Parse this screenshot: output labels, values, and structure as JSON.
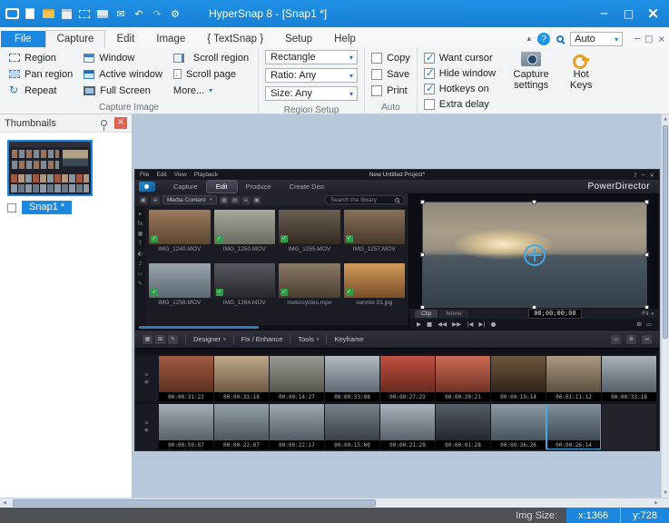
{
  "icons": {
    "minimize": "─",
    "maximize": "□",
    "close": "×",
    "chevron_down": "▾",
    "chevron_up": "▴",
    "help": "?",
    "undo": "↶",
    "redo": "↷",
    "gear": "⚙",
    "email": "✉",
    "repeat": "↻",
    "check": "✓",
    "left": "◀",
    "right": "▶",
    "up": "▲",
    "down": "▼"
  },
  "titlebar": {
    "title": "HyperSnap 8 - [Snap1 *]"
  },
  "tab_row": {
    "tabs": [
      {
        "label": "File",
        "is_file": true
      },
      {
        "label": "Capture",
        "is_active": true
      },
      {
        "label": "Edit"
      },
      {
        "label": "Image"
      },
      {
        "label": "{ TextSnap }"
      },
      {
        "label": "Setup"
      },
      {
        "label": "Help"
      }
    ],
    "zoom_value": "Auto"
  },
  "ribbon": {
    "capture_group": {
      "label": "Capture Image",
      "buttons": [
        {
          "label": "Region"
        },
        {
          "label": "Pan region"
        },
        {
          "label": "Repeat"
        },
        {
          "label": "Window"
        },
        {
          "label": "Active window"
        },
        {
          "label": "Full Screen"
        },
        {
          "label": "Scroll region"
        },
        {
          "label": "Scroll page"
        },
        {
          "label": "More..."
        }
      ]
    },
    "region_setup_group": {
      "label": "Region Setup",
      "dropdowns": [
        {
          "value": "Rectangle"
        },
        {
          "value": "Ratio: Any"
        },
        {
          "value": "Size: Any"
        }
      ]
    },
    "auto_group": {
      "label": "Auto",
      "checkboxes": [
        {
          "label": "Copy",
          "checked": false
        },
        {
          "label": "Save",
          "checked": false
        },
        {
          "label": "Print",
          "checked": false
        }
      ]
    },
    "options_group": {
      "label": "",
      "checkboxes": [
        {
          "label": "Want cursor",
          "checked": true
        },
        {
          "label": "Hide window",
          "checked": true
        },
        {
          "label": "Hotkeys on",
          "checked": true
        },
        {
          "label": "Extra delay",
          "checked": false
        }
      ],
      "buttons": [
        {
          "label": "Capture settings"
        },
        {
          "label": "Hot Keys"
        }
      ]
    }
  },
  "thumbnails_panel": {
    "title": "Thumbnails",
    "item_label": "Snap1 *"
  },
  "status_bar": {
    "img_size_label": "Img Size:",
    "x_value": "x:1366",
    "y_value": "y:728"
  },
  "powerdirector": {
    "menu_items": [
      "File",
      "Edit",
      "View",
      "Playback"
    ],
    "window_glyphs": [
      "?",
      "─",
      "×"
    ],
    "project_title": "New Untitled Project*",
    "brand": "PowerDirector",
    "tabs": [
      {
        "label": "Capture"
      },
      {
        "label": "Edit",
        "active": true
      },
      {
        "label": "Produce"
      },
      {
        "label": "Create Disc"
      }
    ],
    "library": {
      "toolbar_icons_left": [
        "▣",
        "⊕"
      ],
      "content_dropdown": "Media Content",
      "view_icons": [
        "▦",
        "▤",
        "≡",
        "▣"
      ],
      "search_placeholder": "Search the library",
      "sidebar_glyphs": [
        "▸",
        "fx",
        "▦",
        "T",
        "◐",
        "♪",
        "▭",
        "✎"
      ],
      "items": [
        {
          "name": "IMG_1240.MOV",
          "tint1": "#9a7a5c",
          "tint2": "#5c4632"
        },
        {
          "name": "IMG_1250.MOV",
          "tint1": "#a8a89e",
          "tint2": "#6a6a60"
        },
        {
          "name": "IMG_1255.MOV",
          "tint1": "#6a5f52",
          "tint2": "#332a22"
        },
        {
          "name": "IMG_1257.MOV",
          "tint1": "#8a7258",
          "tint2": "#46382a"
        },
        {
          "name": "IMG_1258.MOV",
          "tint1": "#9aa6ae",
          "tint2": "#5a6670"
        },
        {
          "name": "IMG_1264.MOV",
          "tint1": "#585860",
          "tint2": "#26262c"
        },
        {
          "name": "motorcycles.mpo",
          "tint1": "#8a7a66",
          "tint2": "#4a3e32"
        },
        {
          "name": "sunmix 01.jpg",
          "tint1": "#d09a58",
          "tint2": "#7a4e28"
        }
      ]
    },
    "preview": {
      "clip_label": "Clip",
      "movie_label": "Movie",
      "timecode": "00;00;00;00",
      "fit_label": "Fit",
      "transport_glyphs": [
        "▶",
        "■",
        "◀◀",
        "▶▶",
        "|◀",
        "▶|",
        "●"
      ],
      "right_glyphs": [
        "⊞",
        "▭"
      ]
    },
    "toolbar": {
      "left_icons": [
        "▦",
        "⊞",
        "✎"
      ],
      "designer": "Designer",
      "fix_enhance": "Fix / Enhance",
      "tools": "Tools",
      "keyframe": "Keyframe",
      "right_icons": [
        "▭",
        "⚙",
        "↔"
      ]
    },
    "timeline": {
      "header_glyphs": [
        "≡",
        "◉"
      ],
      "row1": [
        {
          "time": "00:00:31:22",
          "tint1": "#a05a42",
          "tint2": "#5c3020"
        },
        {
          "time": "00:00:33:18",
          "tint1": "#c0a888",
          "tint2": "#6e5a44"
        },
        {
          "time": "00:00:14:27",
          "tint1": "#9a9a94",
          "tint2": "#56564e"
        },
        {
          "time": "00:00:33:08",
          "tint1": "#b2bac2",
          "tint2": "#5e6a74"
        },
        {
          "time": "00:00:27:23",
          "tint1": "#c05040",
          "tint2": "#6a2a20"
        },
        {
          "time": "00:00:20:21",
          "tint1": "#cc6a52",
          "tint2": "#703226"
        },
        {
          "time": "00:00:19:14",
          "tint1": "#6e563e",
          "tint2": "#32241a"
        },
        {
          "time": "00:01:11:12",
          "tint1": "#ab9a82",
          "tint2": "#5a4e3e"
        },
        {
          "time": "00:00:33:18",
          "tint1": "#aab2ba",
          "tint2": "#565f68"
        }
      ],
      "row2": [
        {
          "time": "00:00:50:07",
          "tint1": "#a4aeb6",
          "tint2": "#57616a"
        },
        {
          "time": "00:00:22:07",
          "tint1": "#94a0a8",
          "tint2": "#4c565e"
        },
        {
          "time": "00:00:22:17",
          "tint1": "#9ea8b0",
          "tint2": "#525c64"
        },
        {
          "time": "00:00:15:00",
          "tint1": "#788088",
          "tint2": "#3a4046"
        },
        {
          "time": "00:00:21:29",
          "tint1": "#aab4bc",
          "tint2": "#58626a"
        },
        {
          "time": "00:00:01:28",
          "tint1": "#565c64",
          "tint2": "#24282e"
        },
        {
          "time": "00:00:36:26",
          "tint1": "#8c98a2",
          "tint2": "#46525c"
        },
        {
          "time": "00:00:26:14",
          "tint1": "#82909a",
          "tint2": "#3e4a54",
          "selected": true
        }
      ]
    }
  }
}
